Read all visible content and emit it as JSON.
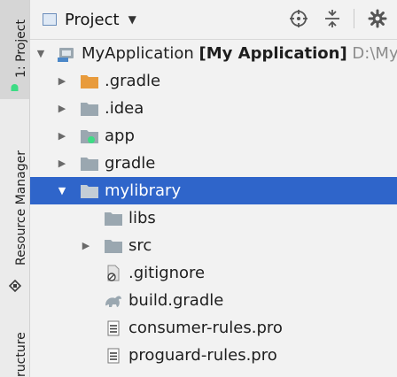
{
  "left_strip": {
    "project_tab": "1: Project",
    "resource_manager_tab": "Resource Manager",
    "structure_tab": "ructure"
  },
  "header": {
    "title": "Project",
    "icons": [
      "locate-icon",
      "collapse-all-icon",
      "settings-icon"
    ]
  },
  "tree": {
    "root_name": "MyApplication",
    "root_module": "[My Application]",
    "root_path": "D:\\MyA",
    "items": [
      {
        "label": "MyApplication",
        "icon": "module-icon",
        "expanded": true
      },
      {
        "label": ".gradle",
        "icon": "folder-orange-icon",
        "expanded": false
      },
      {
        "label": ".idea",
        "icon": "folder-icon",
        "expanded": false
      },
      {
        "label": "app",
        "icon": "module-folder-icon",
        "expanded": false
      },
      {
        "label": "gradle",
        "icon": "folder-icon",
        "expanded": false
      },
      {
        "label": "mylibrary",
        "icon": "folder-icon",
        "expanded": true,
        "selected": true
      },
      {
        "label": "libs",
        "icon": "folder-icon"
      },
      {
        "label": "src",
        "icon": "folder-icon",
        "expanded": false
      },
      {
        "label": ".gitignore",
        "icon": "gitignore-file-icon"
      },
      {
        "label": "build.gradle",
        "icon": "gradle-file-icon"
      },
      {
        "label": "consumer-rules.pro",
        "icon": "text-file-icon"
      },
      {
        "label": "proguard-rules.pro",
        "icon": "text-file-icon"
      }
    ]
  },
  "colors": {
    "selection": "#2f65ca",
    "folder": "#9aa7b0",
    "orange_folder": "#e89b3c",
    "background": "#f2f2f2"
  }
}
